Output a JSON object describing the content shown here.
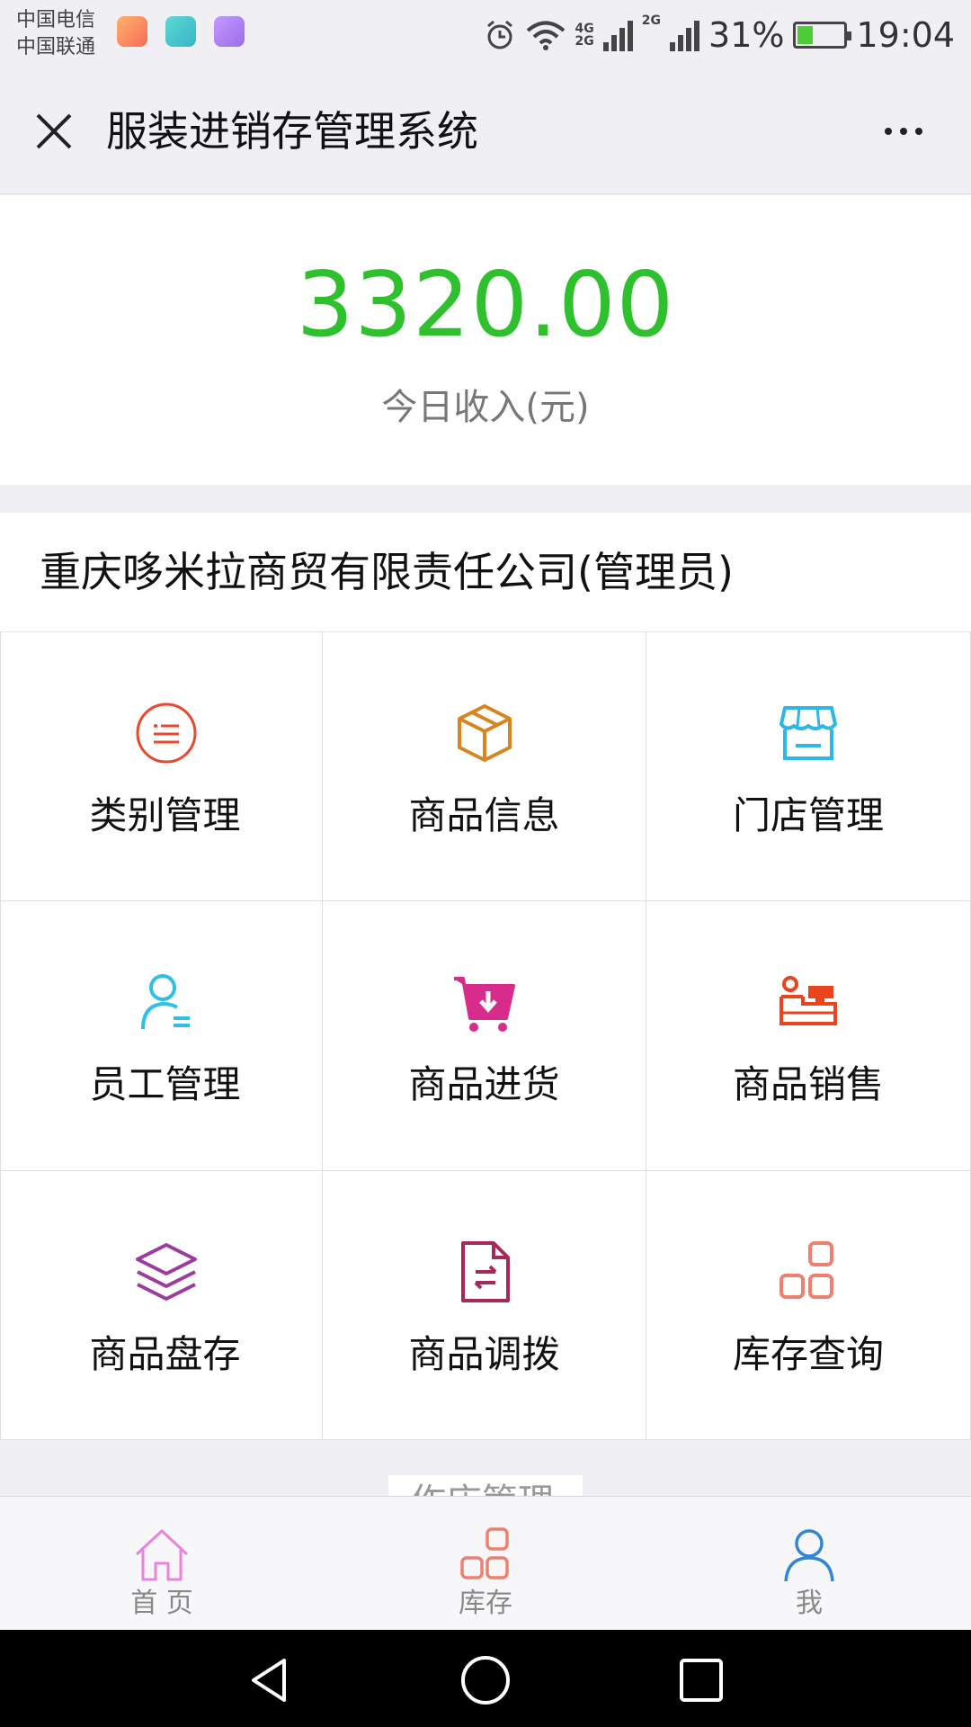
{
  "status_bar": {
    "carrier_1": "中国电信",
    "carrier_2": "中国联通",
    "net_1": "4G",
    "net_1b": "2G",
    "net_2": "2G",
    "battery_percent": "31%",
    "battery_level": 0.31,
    "time": "19:04"
  },
  "header": {
    "title": "服装进销存管理系统"
  },
  "income": {
    "value": "3320.00",
    "label": "今日收入(元)"
  },
  "company": {
    "name": "重庆哆米拉商贸有限责任公司(管理员)"
  },
  "grid": {
    "items": [
      {
        "label": "类别管理",
        "icon": "category-list-icon",
        "color": "#e8482c"
      },
      {
        "label": "商品信息",
        "icon": "package-box-icon",
        "color": "#d8841f"
      },
      {
        "label": "门店管理",
        "icon": "store-icon",
        "color": "#2cb7e6"
      },
      {
        "label": "员工管理",
        "icon": "employee-icon",
        "color": "#2ec0e8"
      },
      {
        "label": "商品进货",
        "icon": "shopping-cart-download-icon",
        "color": "#d72c8c"
      },
      {
        "label": "商品销售",
        "icon": "cash-register-icon",
        "color": "#e8451f"
      },
      {
        "label": "商品盘存",
        "icon": "layers-icon",
        "color": "#9b3c9e"
      },
      {
        "label": "商品调拨",
        "icon": "transfer-document-icon",
        "color": "#a52a5a"
      },
      {
        "label": "库存查询",
        "icon": "inventory-grid-icon",
        "color": "#ef8070"
      }
    ]
  },
  "partial_section": {
    "label": "作店管理"
  },
  "tabbar": {
    "tabs": [
      {
        "label": "首 页",
        "icon": "home-icon",
        "color": "#e982e0"
      },
      {
        "label": "库存",
        "icon": "inventory-grid-icon",
        "color": "#ef8070"
      },
      {
        "label": "我",
        "icon": "user-icon",
        "color": "#2f86d6"
      }
    ]
  }
}
